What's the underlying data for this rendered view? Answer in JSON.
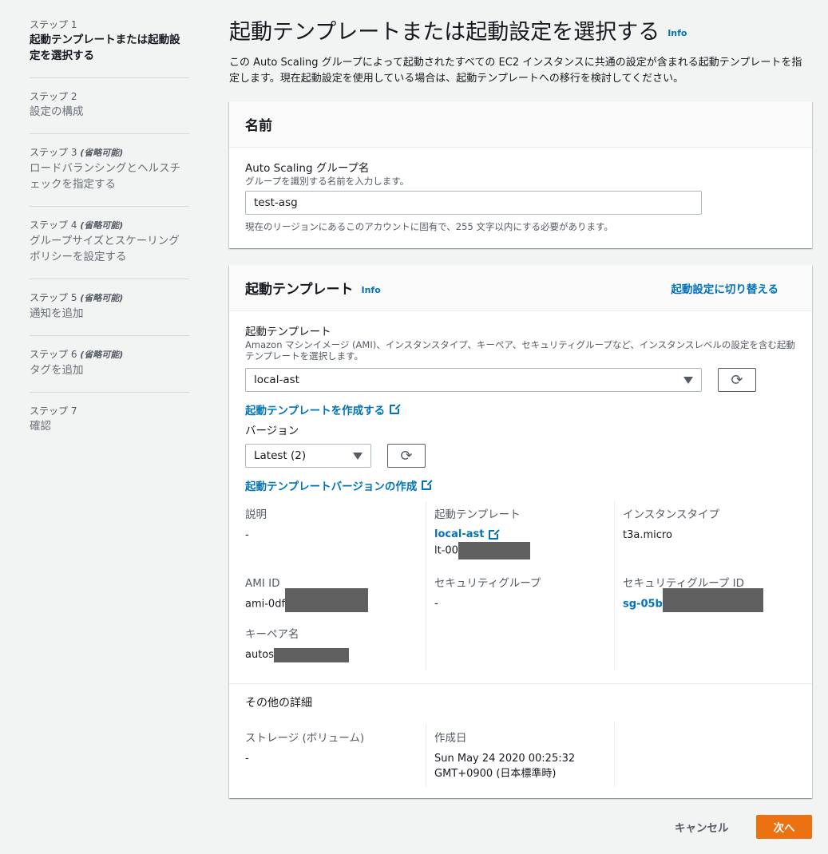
{
  "steps": [
    {
      "label": "ステップ 1",
      "optional": "",
      "title": "起動テンプレートまたは起動設定を選択する"
    },
    {
      "label": "ステップ 2",
      "optional": "",
      "title": "設定の構成"
    },
    {
      "label": "ステップ 3",
      "optional": "(省略可能)",
      "title": "ロードバランシングとヘルスチェックを指定する"
    },
    {
      "label": "ステップ 4",
      "optional": "(省略可能)",
      "title": "グループサイズとスケーリングポリシーを設定する"
    },
    {
      "label": "ステップ 5",
      "optional": "(省略可能)",
      "title": "通知を追加"
    },
    {
      "label": "ステップ 6",
      "optional": "(省略可能)",
      "title": "タグを追加"
    },
    {
      "label": "ステップ 7",
      "optional": "",
      "title": "確認"
    }
  ],
  "page": {
    "title": "起動テンプレートまたは起動設定を選択する",
    "info": "Info",
    "description": "この Auto Scaling グループによって起動されたすべての EC2 インスタンスに共通の設定が含まれる起動テンプレートを指定します。現在起動設定を使用している場合は、起動テンプレートへの移行を検討してください。"
  },
  "name_card": {
    "header": "名前",
    "field_label": "Auto Scaling グループ名",
    "field_desc": "グループを識別する名前を入力します。",
    "value": "test-asg",
    "hint": "現在のリージョンにあるこのアカウントに固有で、255 文字以内にする必要があります。"
  },
  "template_card": {
    "header": "起動テンプレート",
    "info": "Info",
    "switch_link": "起動設定に切り替える",
    "template_label": "起動テンプレート",
    "template_desc": "Amazon マシンイメージ (AMI)、インスタンスタイプ、キーペア、セキュリティグループなど、インスタンスレベルの設定を含む起動テンプレートを選択します。",
    "template_value": "local-ast",
    "create_template_link": "起動テンプレートを作成する",
    "version_label": "バージョン",
    "version_value": "Latest (2)",
    "create_version_link": "起動テンプレートバージョンの作成",
    "details": {
      "description_label": "説明",
      "description_value": "-",
      "template_label": "起動テンプレート",
      "template_link": "local-ast",
      "template_id": "lt-00",
      "instance_type_label": "インスタンスタイプ",
      "instance_type_value": "t3a.micro",
      "ami_label": "AMI ID",
      "ami_value": "ami-0df",
      "sg_label": "セキュリティグループ",
      "sg_value": "-",
      "sg_id_label": "セキュリティグループ ID",
      "sg_id_value": "sg-05b",
      "keypair_label": "キーペア名",
      "keypair_value": "autos"
    },
    "other": {
      "header": "その他の詳細",
      "storage_label": "ストレージ (ボリューム)",
      "storage_value": "-",
      "created_label": "作成日",
      "created_value_1": "Sun May 24 2020 00:25:32",
      "created_value_2": "GMT+0900 (日本標準時)"
    }
  },
  "footer": {
    "cancel": "キャンセル",
    "next": "次へ"
  }
}
